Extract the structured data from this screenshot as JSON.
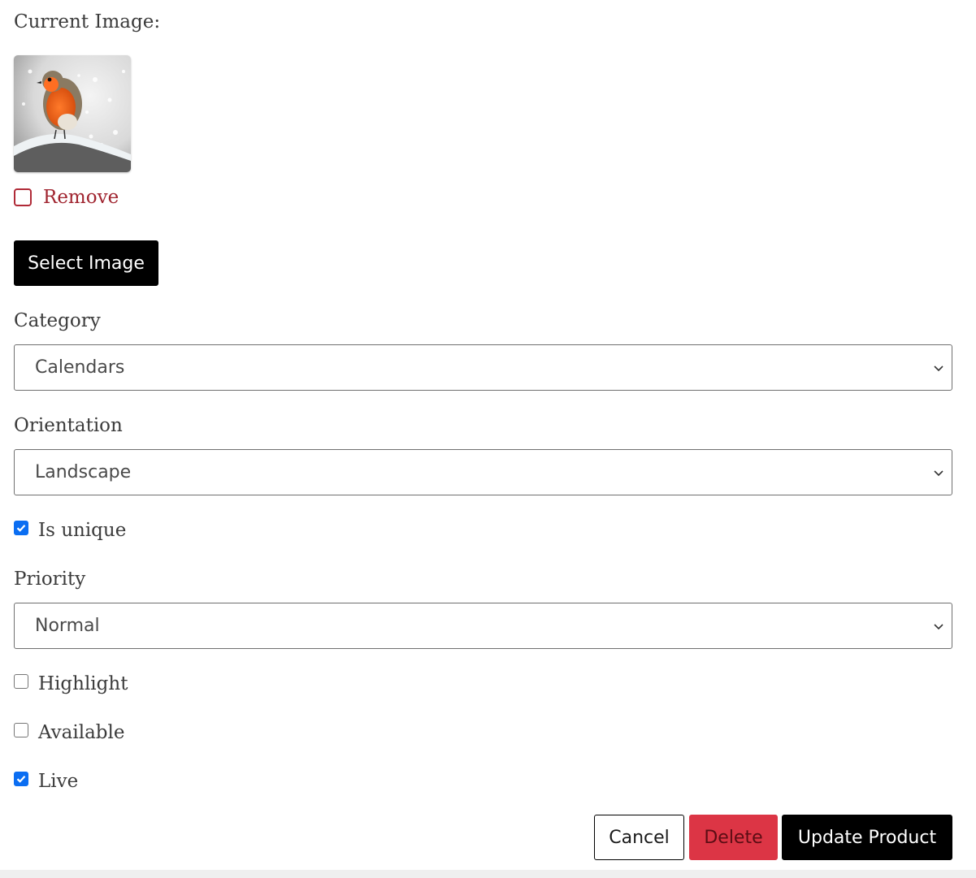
{
  "image_section": {
    "label": "Current Image:",
    "thumbnail": "robin-on-snowy-branch",
    "remove_label": "Remove",
    "remove_checked": false,
    "remove_color": "#a0242f",
    "select_button": "Select Image"
  },
  "fields": {
    "category": {
      "label": "Category",
      "value": "Calendars"
    },
    "orientation": {
      "label": "Orientation",
      "value": "Landscape"
    },
    "is_unique": {
      "label": "Is unique",
      "checked": true
    },
    "priority": {
      "label": "Priority",
      "value": "Normal"
    },
    "highlight": {
      "label": "Highlight",
      "checked": false
    },
    "available": {
      "label": "Available",
      "checked": false
    },
    "live": {
      "label": "Live",
      "checked": true
    }
  },
  "actions": {
    "cancel": "Cancel",
    "delete": "Delete",
    "update": "Update Product",
    "delete_color": "#dc3545",
    "primary_color": "#000000",
    "checkbox_color": "#0b6ef2"
  }
}
